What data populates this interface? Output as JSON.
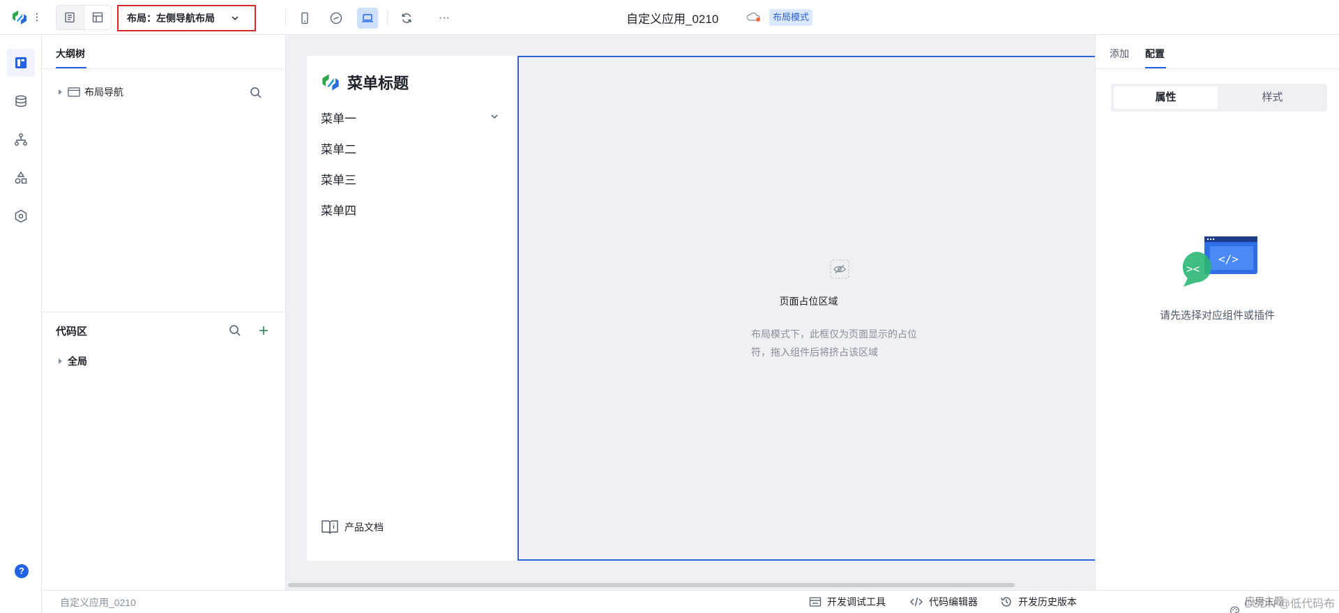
{
  "topbar": {
    "layout_select_label": "布局：左侧导航布局",
    "app_title": "自定义应用_0210",
    "mode_badge": "布局模式",
    "more_label": "···"
  },
  "outline_panel": {
    "tab_label": "大纲树",
    "tree_item": "布局导航",
    "code_title": "代码区",
    "code_tree_item": "全局"
  },
  "canvas": {
    "menu_title": "菜单标题",
    "menu_items": [
      "菜单一",
      "菜单二",
      "菜单三",
      "菜单四"
    ],
    "doc_link": "产品文档",
    "placeholder_title": "页面占位区域",
    "placeholder_desc": "布局模式下，此框仅为页面显示的占位符，拖入组件后将挤占该区域"
  },
  "right_panel": {
    "tabs": [
      "添加",
      "配置"
    ],
    "active_tab": "配置",
    "segments": [
      "属性",
      "样式"
    ],
    "active_segment": "属性",
    "empty_text": "请先选择对应组件或插件"
  },
  "bottom_bar": {
    "app_name": "自定义应用_0210",
    "tools": [
      "开发调试工具",
      "代码编辑器",
      "开发历史版本"
    ],
    "watermark": "CSDN @低代码布道师",
    "theme_label": "应用主题"
  },
  "colors": {
    "accent": "#2162e8",
    "highlight_border": "#d62828",
    "canvas_bg": "#eef0f3"
  }
}
